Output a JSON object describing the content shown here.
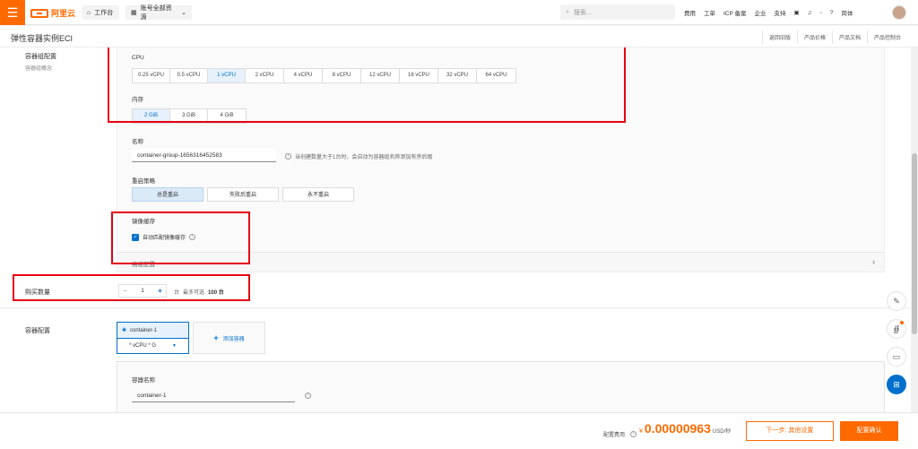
{
  "topbar": {
    "brand": "阿里云",
    "workbench": "工作台",
    "account": "账号全部资源",
    "search_placeholder": "搜索...",
    "links": [
      "费用",
      "工单",
      "ICP 备案",
      "企业",
      "支持",
      "简体"
    ]
  },
  "subheader": {
    "title": "弹性容器实例ECI",
    "links": [
      "返回旧版",
      "产品价格",
      "产品文档",
      "产品控制台"
    ]
  },
  "group_config": {
    "title": "容器组配置",
    "subtitle": "容器组概念",
    "cpu_label": "CPU",
    "cpu_options": [
      "0.25 vCPU",
      "0.5 vCPU",
      "1 vCPU",
      "2 vCPU",
      "4 vCPU",
      "8 vCPU",
      "12 vCPU",
      "16 vCPU",
      "32 vCPU",
      "64 vCPU"
    ],
    "cpu_selected": "1 vCPU",
    "mem_label": "内存",
    "mem_options": [
      "2 GiB",
      "3 GiB",
      "4 GiB"
    ],
    "mem_selected": "2 GiB",
    "name_label": "名称",
    "name_value": "container-group-1656316452583",
    "name_hint": "当创建数量大于1台时，会自动为容器组名称添加有序后缀",
    "restart_label": "重启策略",
    "restart_options": [
      "总是重启",
      "失败后重启",
      "永不重启"
    ],
    "restart_selected": "总是重启",
    "cache_label": "镜像缓存",
    "cache_checkbox": "自动匹配镜像缓存",
    "advanced_label": "高级配置"
  },
  "purchase": {
    "label": "购买数量",
    "quantity": "1",
    "unit": "台",
    "hint_prefix": "最多可选",
    "hint_max": "100 台"
  },
  "container_config": {
    "title": "容器配置",
    "card_name": "container-1",
    "card_spec": "* vCPU * G",
    "add_label": "添加容器",
    "name_label": "容器名称",
    "name_value": "container-1"
  },
  "bottombar": {
    "fee_label": "配置费用:",
    "currency": "¥",
    "amount": "0.00000963",
    "unit": "USD/秒",
    "next_button": "下一步: 其他设置",
    "confirm_button": "配置确认"
  },
  "icons": [
    "menu-icon",
    "home-icon",
    "search-icon",
    "bell-icon",
    "help-icon",
    "edit-icon",
    "chat-icon",
    "apps-icon"
  ]
}
